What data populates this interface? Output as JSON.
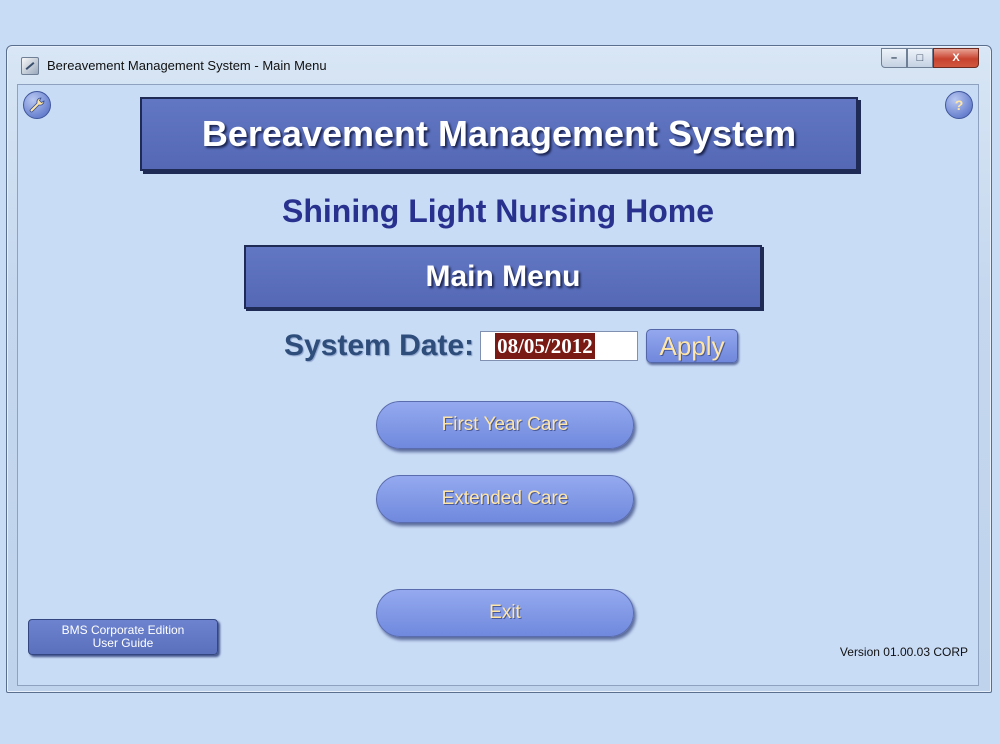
{
  "window": {
    "title": "Bereavement Management System - Main Menu",
    "controls": {
      "minimize": "–",
      "maximize": "□",
      "close": "X"
    }
  },
  "toolbar": {
    "settings_icon": "wrench-icon",
    "help_label": "?"
  },
  "header": {
    "banner": "Bereavement Management System",
    "facility": "Shining Light Nursing Home",
    "menu_title": "Main Menu"
  },
  "system_date": {
    "label": "System Date:",
    "value": "08/05/2012",
    "apply_label": "Apply"
  },
  "menu": {
    "first_year_care": "First Year Care",
    "extended_care": "Extended Care",
    "exit": "Exit"
  },
  "footer": {
    "guide_line1": "BMS Corporate Edition",
    "guide_line2": "User Guide",
    "version": "Version 01.00.03 CORP"
  },
  "colors": {
    "background": "#c9dcf6",
    "banner": "#5a6fbe",
    "subtitle": "#29318f",
    "button_text": "#ffe6a6",
    "date_highlight": "#7a1a14"
  }
}
